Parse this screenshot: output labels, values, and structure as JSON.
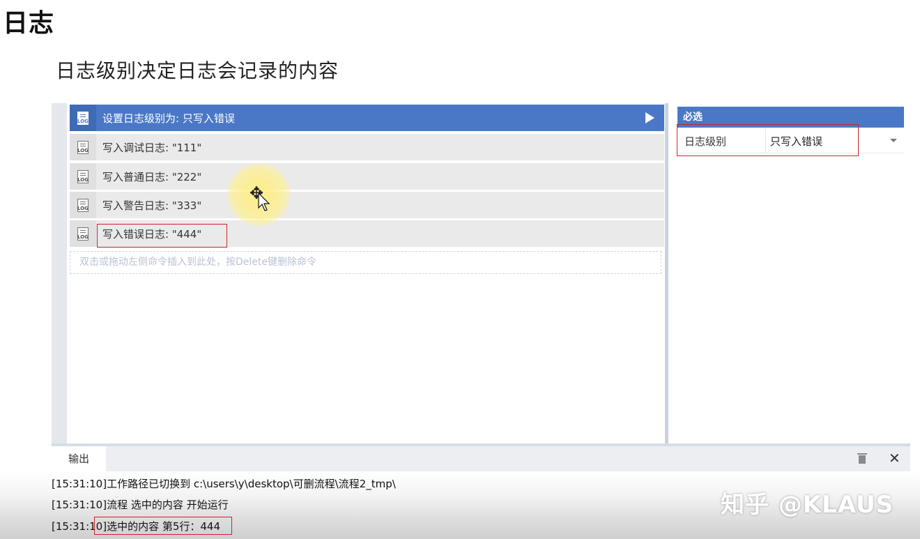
{
  "page": {
    "title": "日志",
    "subtitle": "日志级别决定日志会记录的内容"
  },
  "commands": [
    {
      "label": "设置日志级别为: 只写入错误",
      "icon": "log-settings-icon",
      "selected": true
    },
    {
      "label": "写入调试日志: \"111\"",
      "icon": "log-icon",
      "selected": false
    },
    {
      "label": "写入普通日志: \"222\"",
      "icon": "log-icon",
      "selected": false
    },
    {
      "label": "写入警告日志: \"333\"",
      "icon": "log-icon",
      "selected": false
    },
    {
      "label": "写入错误日志: \"444\"",
      "icon": "log-icon",
      "selected": false
    }
  ],
  "icon_text": "LOG",
  "drop_hint": "双击或拖动左侧命令插入到此处，按Delete键删除命令",
  "properties": {
    "section": "必选",
    "rows": [
      {
        "name": "日志级别",
        "value": "只写入错误"
      }
    ]
  },
  "output": {
    "tab_label": "输出",
    "lines": [
      "[15:31:10]工作路径已切换到 c:\\users\\y\\desktop\\可删流程\\流程2_tmp\\",
      "[15:31:10]流程 选中的内容 开始运行",
      "[15:31:10]选中的内容 第5行：444"
    ]
  },
  "watermark": "知乎 @KLAUS",
  "colors": {
    "accent": "#4a78c6",
    "highlight_border": "#d0202a",
    "cursor_halo": "#ffee78"
  }
}
